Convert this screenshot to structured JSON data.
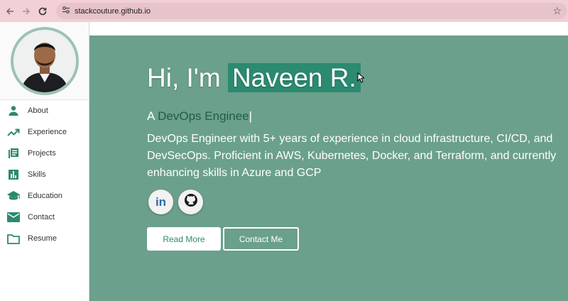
{
  "browser": {
    "url": "stackcouture.github.io"
  },
  "sidebar": {
    "items": [
      {
        "label": "About",
        "icon": "person-icon"
      },
      {
        "label": "Experience",
        "icon": "trending-up-icon"
      },
      {
        "label": "Projects",
        "icon": "projects-icon"
      },
      {
        "label": "Skills",
        "icon": "bar-chart-icon"
      },
      {
        "label": "Education",
        "icon": "graduation-cap-icon"
      },
      {
        "label": "Contact",
        "icon": "mail-icon"
      },
      {
        "label": "Resume",
        "icon": "folder-icon"
      }
    ]
  },
  "hero": {
    "greeting": "Hi, I'm",
    "name": "Naveen R.",
    "role_prefix": "A",
    "role_typed": "DevOps Enginee",
    "caret": "|",
    "description": "DevOps Engineer with 5+ years of experience in cloud infrastructure, CI/CD, and DevSecOps. Proficient in AWS, Kubernetes, Docker, and Terraform, and currently enhancing skills in Azure and GCP",
    "linkedin_text": "in",
    "read_more": "Read More",
    "contact_me": "Contact Me"
  },
  "colors": {
    "accent": "#2b8a70",
    "hero_bg": "#6ba08c",
    "browser_bar": "#f3cfd6"
  }
}
